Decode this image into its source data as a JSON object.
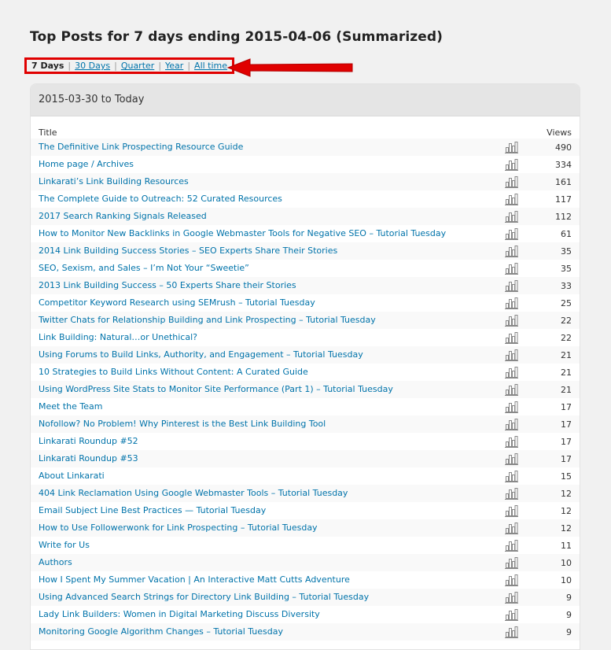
{
  "page": {
    "title": "Top Posts for 7 days ending 2015-04-06 (Summarized)"
  },
  "period_nav": {
    "current": "7 Days",
    "links": [
      "30 Days",
      "Quarter",
      "Year",
      "All time"
    ],
    "separator": "|"
  },
  "panel": {
    "header": "2015-03-30 to Today",
    "columns": {
      "title": "Title",
      "views": "Views"
    },
    "rows": [
      {
        "title": "The Definitive Link Prospecting Resource Guide",
        "views": "490"
      },
      {
        "title": "Home page / Archives",
        "views": "334"
      },
      {
        "title": "Linkarati’s Link Building Resources",
        "views": "161"
      },
      {
        "title": "The Complete Guide to Outreach: 52 Curated Resources",
        "views": "117"
      },
      {
        "title": "2017 Search Ranking Signals Released",
        "views": "112"
      },
      {
        "title": "How to Monitor New Backlinks in Google Webmaster Tools for Negative SEO – Tutorial Tuesday",
        "views": "61"
      },
      {
        "title": "2014 Link Building Success Stories – SEO Experts Share Their Stories",
        "views": "35"
      },
      {
        "title": "SEO, Sexism, and Sales – I’m Not Your “Sweetie”",
        "views": "35"
      },
      {
        "title": "2013 Link Building Success – 50 Experts Share their Stories",
        "views": "33"
      },
      {
        "title": "Competitor Keyword Research using SEMrush – Tutorial Tuesday",
        "views": "25"
      },
      {
        "title": "Twitter Chats for Relationship Building and Link Prospecting – Tutorial Tuesday",
        "views": "22"
      },
      {
        "title": "Link Building: Natural…or Unethical?",
        "views": "22"
      },
      {
        "title": "Using Forums to Build Links, Authority, and Engagement – Tutorial Tuesday",
        "views": "21"
      },
      {
        "title": "10 Strategies to Build Links Without Content: A Curated Guide",
        "views": "21"
      },
      {
        "title": "Using WordPress Site Stats to Monitor Site Performance (Part 1) – Tutorial Tuesday",
        "views": "21"
      },
      {
        "title": "Meet the Team",
        "views": "17"
      },
      {
        "title": "Nofollow? No Problem! Why Pinterest is the Best Link Building Tool",
        "views": "17"
      },
      {
        "title": "Linkarati Roundup #52",
        "views": "17"
      },
      {
        "title": "Linkarati Roundup #53",
        "views": "17"
      },
      {
        "title": "About Linkarati",
        "views": "15"
      },
      {
        "title": "404 Link Reclamation Using Google Webmaster Tools – Tutorial Tuesday",
        "views": "12"
      },
      {
        "title": "Email Subject Line Best Practices — Tutorial Tuesday",
        "views": "12"
      },
      {
        "title": "How to Use Followerwonk for Link Prospecting – Tutorial Tuesday",
        "views": "12"
      },
      {
        "title": "Write for Us",
        "views": "11"
      },
      {
        "title": "Authors",
        "views": "10"
      },
      {
        "title": "How I Spent My Summer Vacation | An Interactive Matt Cutts Adventure",
        "views": "10"
      },
      {
        "title": "Using Advanced Search Strings for Directory Link Building – Tutorial Tuesday",
        "views": "9"
      },
      {
        "title": "Lady Link Builders: Women in Digital Marketing Discuss Diversity",
        "views": "9"
      },
      {
        "title": "Monitoring Google Algorithm Changes – Tutorial Tuesday",
        "views": "9"
      },
      {
        "title": "",
        "views": ""
      }
    ]
  },
  "colors": {
    "link": "#0073aa",
    "highlight_border": "#e00000",
    "background": "#f1f1f1"
  },
  "icons": {
    "row_stats": "bar-chart-icon",
    "annotation": "red-arrow-icon"
  }
}
